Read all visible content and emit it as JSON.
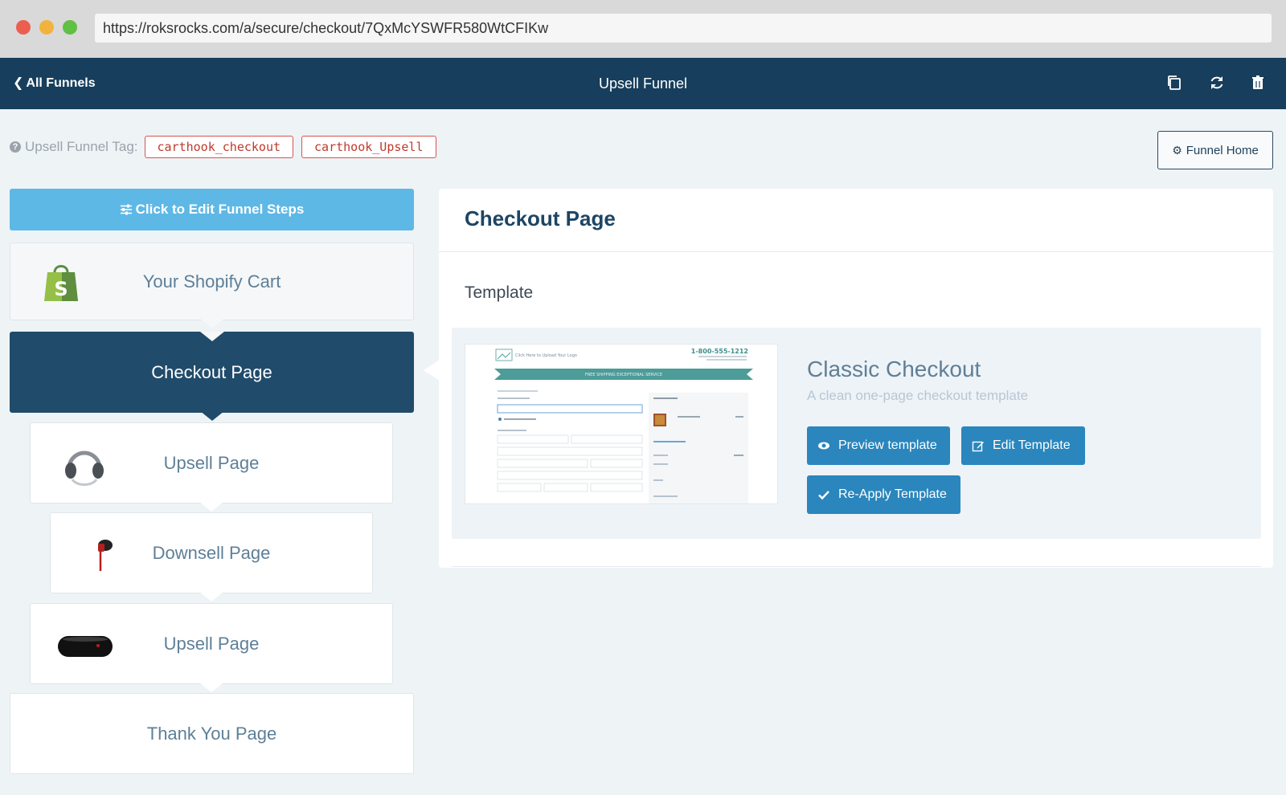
{
  "browser": {
    "url": "https://roksrocks.com/a/secure/checkout/7QxMcYSWFR580WtCFIKw"
  },
  "nav": {
    "back_label": "All Funnels",
    "title": "Upsell Funnel",
    "icons": [
      "copy-icon",
      "refresh-icon",
      "trash-icon"
    ]
  },
  "tags": {
    "label": "Upsell Funnel Tag:",
    "items": [
      "carthook_checkout",
      "carthook_Upsell"
    ]
  },
  "funnel_home_label": "Funnel Home",
  "edit_steps_label": "Click to Edit Funnel Steps",
  "steps": [
    {
      "label": "Your Shopify Cart",
      "icon": "shopify-bag-icon"
    },
    {
      "label": "Checkout Page",
      "active": true
    },
    {
      "label": "Upsell Page",
      "icon": "headphones-image"
    },
    {
      "label": "Downsell Page",
      "icon": "earphone-image"
    },
    {
      "label": "Upsell Page",
      "icon": "speaker-image"
    },
    {
      "label": "Thank You Page"
    }
  ],
  "detail": {
    "title": "Checkout Page",
    "section_label": "Template",
    "template": {
      "name": "Classic Checkout",
      "description": "A clean one-page checkout template",
      "preview": {
        "logo_text": "Click Here to Upload Your Logo",
        "phone": "1-800-555-1212",
        "banner": "FREE SHIPPING EXCEPTIONAL SERVICE"
      }
    },
    "buttons": {
      "preview": "Preview template",
      "edit": "Edit Template",
      "reapply": "Re-Apply Template"
    }
  },
  "colors": {
    "nav_bg": "#173e5c",
    "active_step": "#214b6a",
    "edit_steps_bg": "#5db8e6",
    "primary_button": "#2a86bd",
    "tag_red": "#c0392b"
  }
}
